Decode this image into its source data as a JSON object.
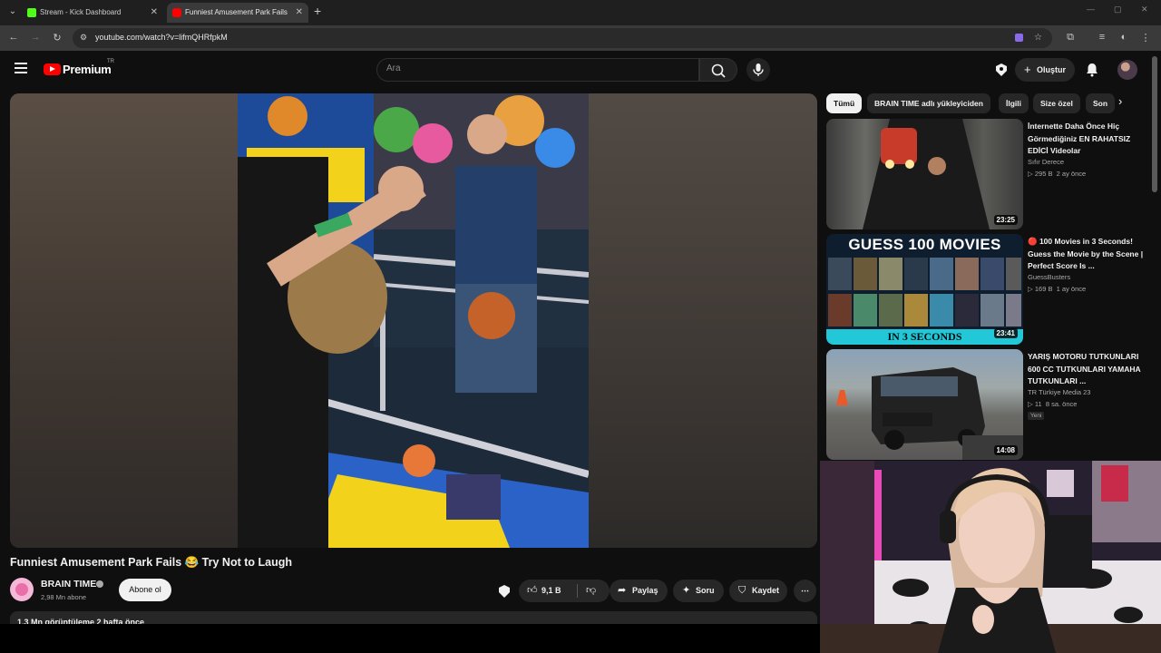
{
  "browser": {
    "tabs": [
      {
        "label": "Stream - Kick Dashboard",
        "close": "✕"
      },
      {
        "label": "Funniest Amusement Park Fails",
        "close": "✕"
      }
    ],
    "new_tab": "+",
    "menu_glyph": "⌄",
    "url": "youtube.com/watch?v=lifmQHRfpkM",
    "window_controls": [
      "—",
      "▢",
      "✕"
    ]
  },
  "youtube": {
    "logo_text": "Premium",
    "country": "TR",
    "search_placeholder": "Ara",
    "create_label": "Oluştur",
    "create_glyph": "+"
  },
  "video": {
    "title": "Funniest Amusement Park Fails 😂 Try Not to Laugh",
    "channel": "BRAIN TIME",
    "subscribers": "2,98 Mn abone",
    "subscribe_label": "Abone ol",
    "likes": "9,1 B",
    "share_label": "Paylaş",
    "ask_label": "Soru",
    "save_label": "Kaydet",
    "more_glyph": "⋯",
    "views_line": "1,3 Mn görüntüleme  2 hafta önce"
  },
  "chips": [
    "Tümü",
    "BRAIN TIME adlı yükleyiciden",
    "İlgili",
    "Size özel",
    "Son"
  ],
  "chip_arrow": "›",
  "recommendations": [
    {
      "title": "İnternette Daha Önce Hiç Görmediğiniz EN RAHATSIZ EDİCİ Videolar",
      "channel": "Sıfır Derece",
      "views": "295 B",
      "age": "2 ay önce",
      "duration": "23:25"
    },
    {
      "title": "🔴 100 Movies in 3 Seconds! Guess the Movie by the Scene | Perfect Score Is ...",
      "channel": "GuessBusters",
      "views": "169 B",
      "age": "1 ay önce",
      "duration": "23:41",
      "thumb_top": "GUESS 100 MOVIES",
      "thumb_bottom": "IN 3 SECONDS"
    },
    {
      "title": "YARIŞ MOTORU TUTKUNLARI 600 CC TUTKUNLARI YAMAHA TUTKUNLARI ...",
      "channel": "TR Türkiye Media 23",
      "views": "11",
      "age": "8 sa. önce",
      "badge": "Yeni",
      "duration": "14:08"
    }
  ],
  "colors": {
    "yt_red": "#ff0000",
    "kick_green": "#53fc18",
    "background": "#0f0f0f",
    "chip_bg": "#272727"
  }
}
